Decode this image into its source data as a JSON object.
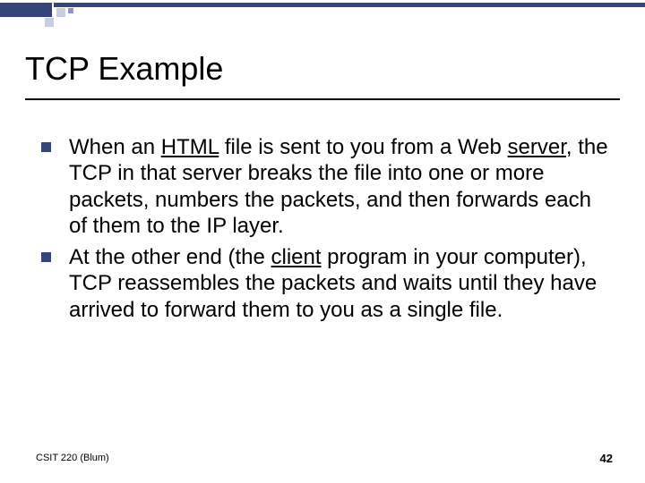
{
  "slide": {
    "title": "TCP Example",
    "bullets": [
      {
        "segments": [
          {
            "t": "When an "
          },
          {
            "t": "HTML",
            "u": true
          },
          {
            "t": " file is sent to you from a Web "
          },
          {
            "t": "server",
            "u": true
          },
          {
            "t": ", the TCP in that server breaks the file into one or more packets, numbers the packets, and then forwards each of them to the IP layer."
          }
        ]
      },
      {
        "segments": [
          {
            "t": "At the other end (the "
          },
          {
            "t": "client",
            "u": true
          },
          {
            "t": " program in your computer), TCP reassembles the packets and waits until they have arrived to forward them to you as a single file."
          }
        ]
      }
    ],
    "footer_left": "CSIT 220 (Blum)",
    "footer_right": "42"
  }
}
